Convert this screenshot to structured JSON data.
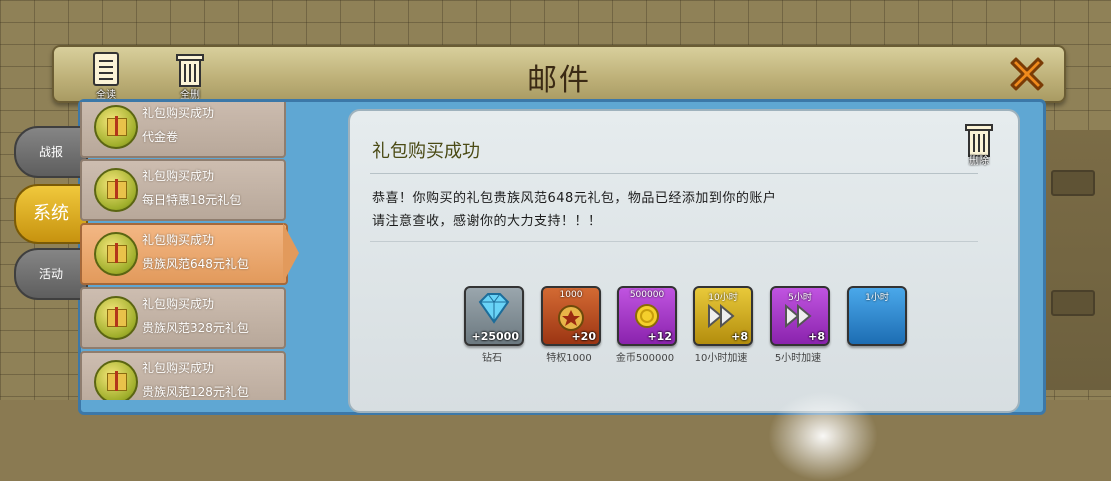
{
  "header": {
    "title": "邮件",
    "read_all_label": "全读",
    "delete_all_label": "全删"
  },
  "side_tabs": [
    "战报",
    "系统",
    "活动"
  ],
  "mail_list": [
    {
      "title": "礼包购买成功",
      "subtitle": "代金卷"
    },
    {
      "title": "礼包购买成功",
      "subtitle": "每日特惠18元礼包"
    },
    {
      "title": "礼包购买成功",
      "subtitle": "贵族风范648元礼包"
    },
    {
      "title": "礼包购买成功",
      "subtitle": "贵族风范328元礼包"
    },
    {
      "title": "礼包购买成功",
      "subtitle": "贵族风范128元礼包"
    }
  ],
  "mail": {
    "title": "礼包购买成功",
    "delete_label": "删除",
    "body_line1": "恭喜！你购买的礼包贵族风范648元礼包，物品已经添加到你的账户",
    "body_line2": "请注意查收，感谢你的大力支持！！！"
  },
  "rewards": [
    {
      "name": "钻石",
      "qty": "+25000",
      "top": "",
      "color": "#7d8a91"
    },
    {
      "name": "特权1000",
      "qty": "+20",
      "top": "1000",
      "color": "#b5431e"
    },
    {
      "name": "金币500000",
      "qty": "+12",
      "top": "500000",
      "color": "#9c2fbf"
    },
    {
      "name": "10小时加速",
      "qty": "+8",
      "top": "10小时",
      "color": "#c9a51a"
    },
    {
      "name": "5小时加速",
      "qty": "+8",
      "top": "5小时",
      "color": "#9c2fbf"
    },
    {
      "name": "",
      "qty": "",
      "top": "1小时",
      "color": "#2f8ad6"
    }
  ]
}
